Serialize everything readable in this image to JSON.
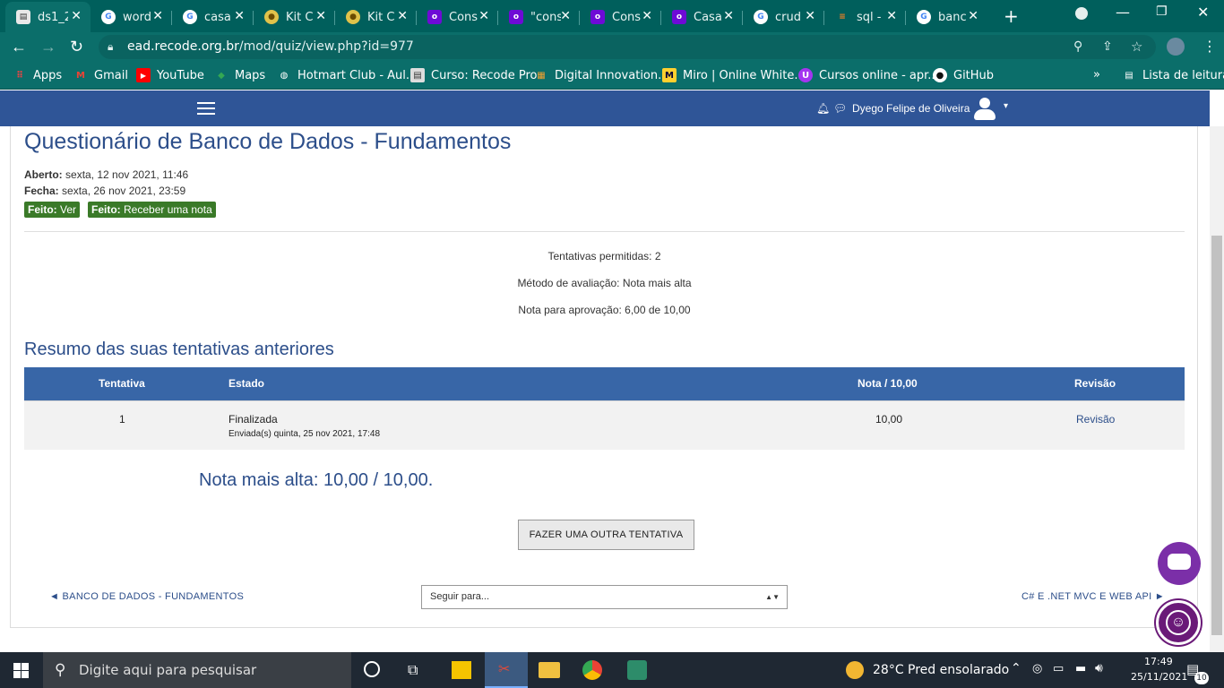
{
  "browser": {
    "tabs": [
      {
        "title": "ds1_2",
        "icon": "document-icon"
      },
      {
        "title": "word",
        "icon": "google-icon"
      },
      {
        "title": "casa",
        "icon": "google-icon"
      },
      {
        "title": "Kit C",
        "icon": "kit-icon"
      },
      {
        "title": "Kit C",
        "icon": "kit-icon"
      },
      {
        "title": "Cons",
        "icon": "olx-icon"
      },
      {
        "title": "\"cons",
        "icon": "olx-icon"
      },
      {
        "title": "Cons",
        "icon": "olx-icon"
      },
      {
        "title": "Casa",
        "icon": "olx-icon"
      },
      {
        "title": "crud",
        "icon": "google-icon"
      },
      {
        "title": "sql -",
        "icon": "stackoverflow-icon"
      },
      {
        "title": "banc",
        "icon": "google-icon"
      }
    ],
    "url_host": "ead.recode.org.br",
    "url_path": "/mod/quiz/view.php?id=977",
    "bookmarks": [
      {
        "label": "Apps"
      },
      {
        "label": "Gmail"
      },
      {
        "label": "YouTube"
      },
      {
        "label": "Maps"
      },
      {
        "label": "Hotmart Club - Aul..."
      },
      {
        "label": "Curso: Recode Pro"
      },
      {
        "label": "Digital Innovation..."
      },
      {
        "label": "Miro | Online White..."
      },
      {
        "label": "Cursos online - apr..."
      },
      {
        "label": "GitHub"
      }
    ],
    "reading_list": "Lista de leitura"
  },
  "header": {
    "user_name": "Dyego Felipe de Oliveira"
  },
  "quiz": {
    "title": "Questionário de Banco de Dados - Fundamentos",
    "opened_label": "Aberto:",
    "opened_value": "sexta, 12 nov 2021, 11:46",
    "closes_label": "Fecha:",
    "closes_value": "sexta, 26 nov 2021, 23:59",
    "badge1_label": "Feito:",
    "badge1_value": "Ver",
    "badge2_label": "Feito:",
    "badge2_value": "Receber uma nota",
    "attempts_allowed": "Tentativas permitidas: 2",
    "grading_method": "Método de avaliação: Nota mais alta",
    "pass_grade": "Nota para aprovação: 6,00 de 10,00",
    "summary_title": "Resumo das suas tentativas anteriores",
    "table_headers": {
      "attempt": "Tentativa",
      "state": "Estado",
      "grade": "Nota / 10,00",
      "review": "Revisão"
    },
    "rows": [
      {
        "attempt": "1",
        "state": "Finalizada",
        "submitted": "Enviada(s) quinta, 25 nov 2021, 17:48",
        "grade": "10,00",
        "review": "Revisão"
      }
    ],
    "highest_grade": "Nota mais alta: 10,00 / 10,00.",
    "retry_button": "FAZER UMA OUTRA TENTATIVA",
    "prev_link": "◄ BANCO DE DADOS - FUNDAMENTOS",
    "jump_placeholder": "Seguir para...",
    "next_link": "C# E .NET MVC E WEB API ►"
  },
  "taskbar": {
    "search_placeholder": "Digite aqui para pesquisar",
    "weather": "28°C  Pred ensolarado",
    "time": "17:49",
    "date": "25/11/2021",
    "notifications": "10"
  },
  "colors": {
    "chrome": "#0b6e6a",
    "moodle_header": "#2f5597",
    "table_header": "#3866a7",
    "heading": "#2c4e8a",
    "badge": "#3a7a28"
  }
}
